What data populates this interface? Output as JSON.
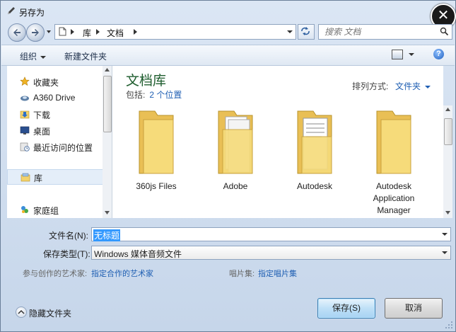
{
  "window": {
    "title": "另存为",
    "close_label": "✕"
  },
  "nav": {
    "breadcrumb": [
      "库",
      "文档"
    ]
  },
  "search": {
    "placeholder": "搜索 文档"
  },
  "toolbar": {
    "organize_label": "组织",
    "new_folder_label": "新建文件夹",
    "help_label": "?"
  },
  "sidebar": {
    "items": [
      {
        "label": "收藏夹",
        "icon": "star-icon"
      },
      {
        "label": "A360 Drive",
        "icon": "cloud-drive-icon"
      },
      {
        "label": "下载",
        "icon": "download-folder-icon"
      },
      {
        "label": "桌面",
        "icon": "desktop-icon"
      },
      {
        "label": "最近访问的位置",
        "icon": "recent-places-icon"
      },
      {
        "label": "库",
        "icon": "library-icon",
        "selected": true
      },
      {
        "label": "家庭组",
        "icon": "homegroup-icon"
      }
    ]
  },
  "library": {
    "title": "文档库",
    "includes_label": "包括:",
    "locations_link": "2 个位置",
    "arrange_label": "排列方式:",
    "arrange_value": "文件夹",
    "folders": [
      {
        "label": "360js Files"
      },
      {
        "label": "Adobe"
      },
      {
        "label": "Autodesk"
      },
      {
        "label": "Autodesk Application Manager"
      }
    ]
  },
  "form": {
    "filename_label": "文件名(N):",
    "filename_value": "无标题",
    "filetype_label": "保存类型(T):",
    "filetype_value": "Windows 媒体音频文件",
    "artist_label": "参与创作的艺术家:",
    "artist_link": "指定合作的艺术家",
    "album_label": "唱片集:",
    "album_link": "指定唱片集"
  },
  "footer": {
    "hide_folders_label": "隐藏文件夹",
    "save_label": "保存(S)",
    "cancel_label": "取消"
  },
  "colors": {
    "accent_link": "#1f5fb3",
    "folder_yellow": "#f3d26b",
    "library_title": "#1e5d2e"
  }
}
